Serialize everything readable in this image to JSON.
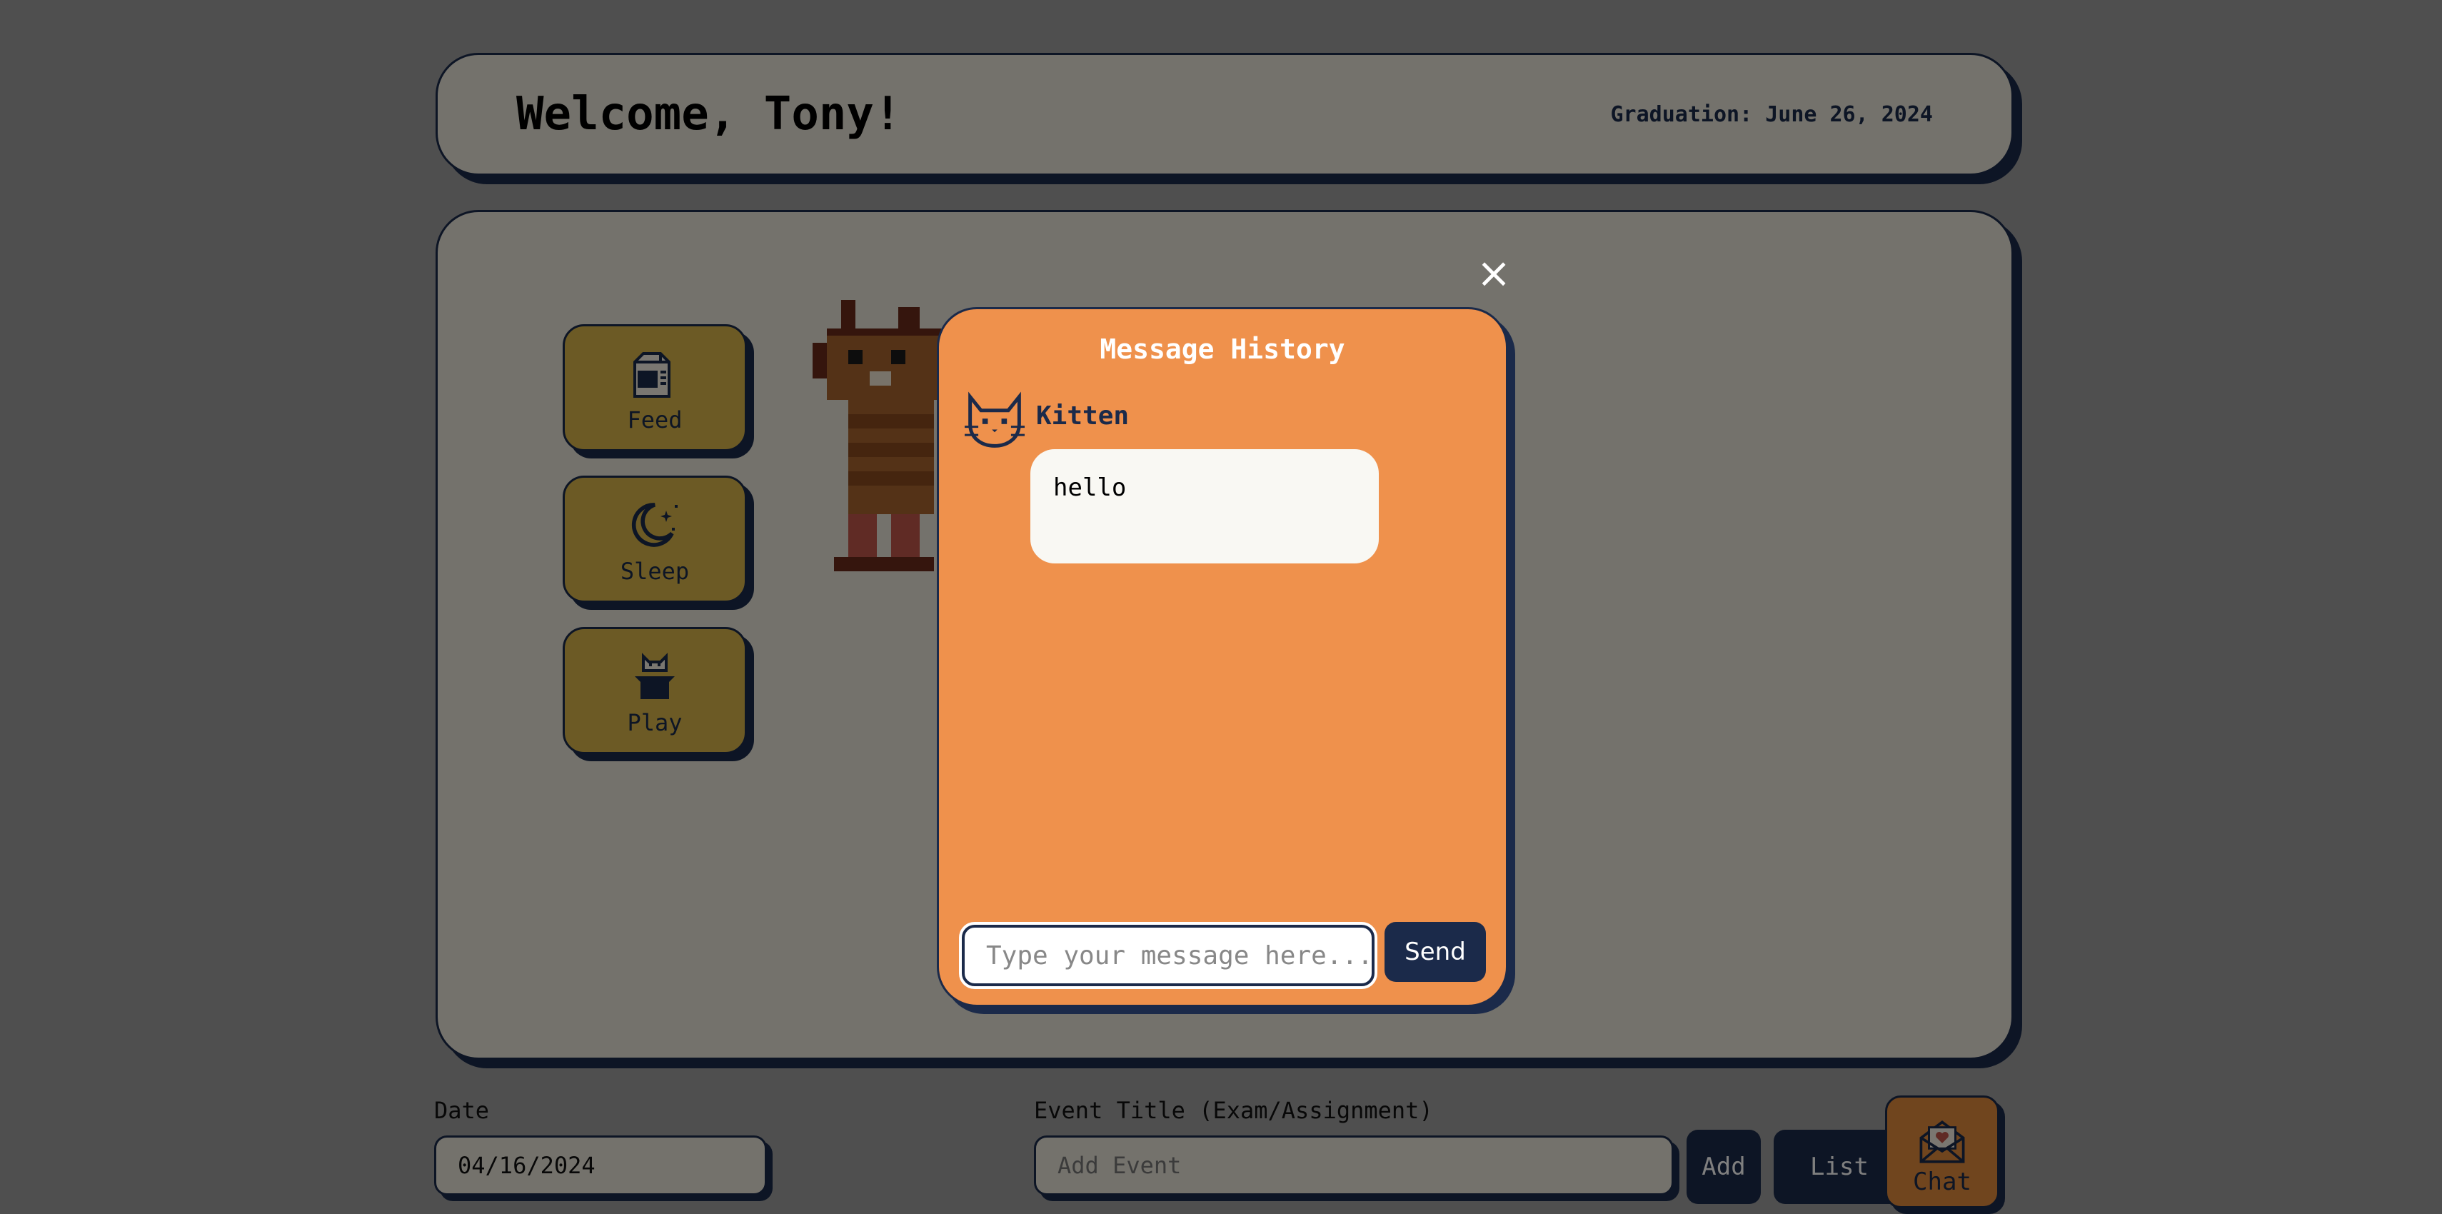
{
  "header": {
    "welcome": "Welcome, Tony!",
    "graduation": "Graduation: June 26, 2024"
  },
  "actions": {
    "feed": "Feed",
    "sleep": "Sleep",
    "play": "Play"
  },
  "form": {
    "date_label": "Date",
    "date_value": "04/16/2024",
    "event_label": "Event Title (Exam/Assignment)",
    "event_placeholder": "Add Event",
    "add_label": "Add",
    "list_label": "List"
  },
  "chat_button": {
    "label": "Chat"
  },
  "modal": {
    "close": "×",
    "title": "Message History",
    "messages": [
      {
        "sender": "Kitten",
        "text": "hello"
      }
    ],
    "input_placeholder": "Type your message here...",
    "send_label": "Send"
  },
  "colors": {
    "navy": "#1b2a4a",
    "panel": "#e8e4d8",
    "action_button": "#d8b54a",
    "modal": "#ef914c",
    "chat_button": "#e08a3c"
  },
  "icons": [
    "milk-carton-icon",
    "moon-stars-icon",
    "cat-in-hat-icon",
    "envelope-heart-icon",
    "cat-face-icon"
  ]
}
